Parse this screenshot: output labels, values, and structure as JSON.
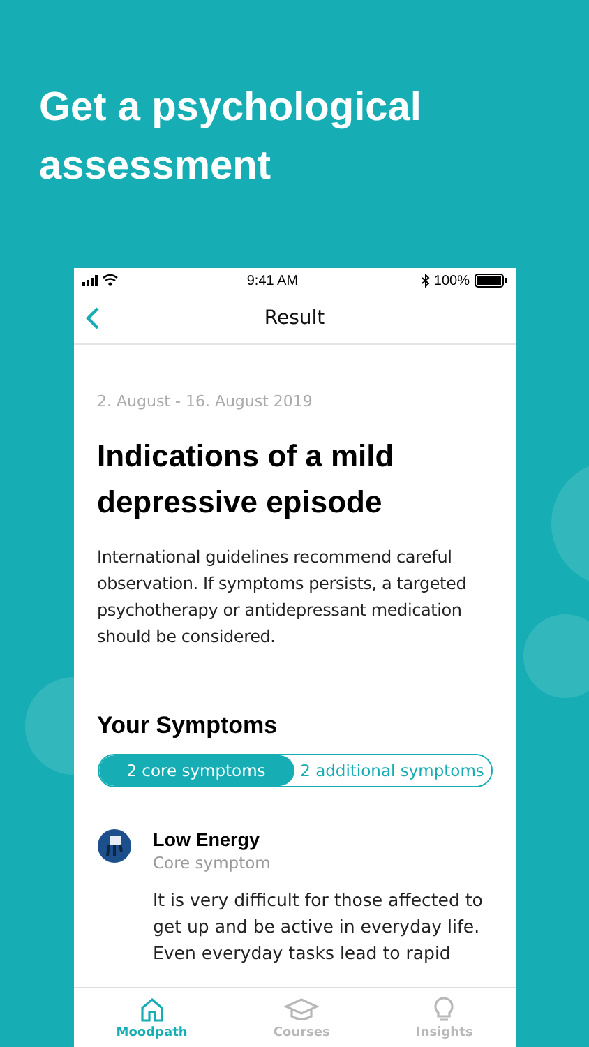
{
  "headline": "Get a psychological assessment",
  "status_bar": {
    "time": "9:41 AM",
    "battery": "100%"
  },
  "nav": {
    "title": "Result"
  },
  "result": {
    "date_range": "2. August - 16. August 2019",
    "title": "Indications of a mild depressive episode",
    "description": "International guidelines recommend careful observation. If symptoms persists, a targeted psychotherapy or antidepressant medication should be considered."
  },
  "symptoms": {
    "heading": "Your Symptoms",
    "segments": [
      {
        "label": "2 core symptoms",
        "selected": true
      },
      {
        "label": "2 additional symptoms",
        "selected": false
      }
    ],
    "items": [
      {
        "name": "Low Energy",
        "category": "Core symptom",
        "description": "It is very difficult for those affected to get up and be active in everyday life. Even everyday tasks lead to rapid"
      }
    ]
  },
  "tab_bar": [
    {
      "label": "Moodpath",
      "kind": "home",
      "selected": true
    },
    {
      "label": "Courses",
      "kind": "courses",
      "selected": false
    },
    {
      "label": "Insights",
      "kind": "insights",
      "selected": false
    }
  ]
}
